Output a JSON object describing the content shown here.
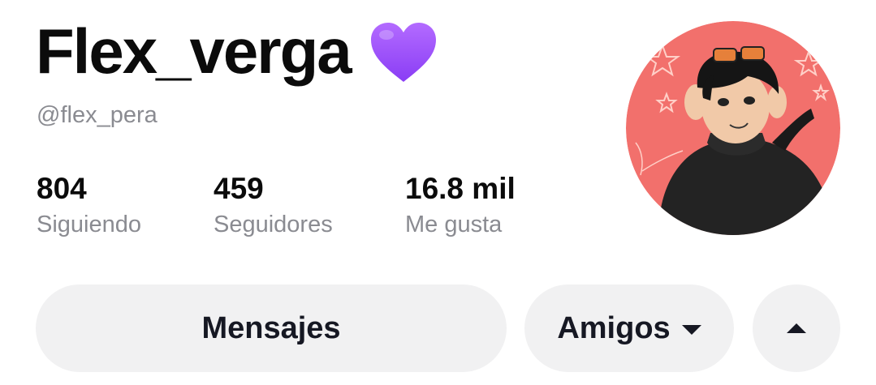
{
  "profile": {
    "display_name": "Flex_verga",
    "name_emoji": "purple-heart-icon",
    "handle": "@flex_pera",
    "avatar_icon": "profile-avatar-illustration"
  },
  "stats": {
    "following": {
      "value": "804",
      "label": "Siguiendo"
    },
    "followers": {
      "value": "459",
      "label": "Seguidores"
    },
    "likes": {
      "value": "16.8 mil",
      "label": "Me gusta"
    }
  },
  "actions": {
    "messages_label": "Mensajes",
    "friends_label": "Amigos",
    "friends_icon": "caret-down-icon",
    "more_icon": "caret-up-icon"
  },
  "colors": {
    "heart": "#9b4dff",
    "avatar_background": "#f2706c",
    "button_background": "#f1f1f2",
    "muted_text": "#8a8b91"
  }
}
